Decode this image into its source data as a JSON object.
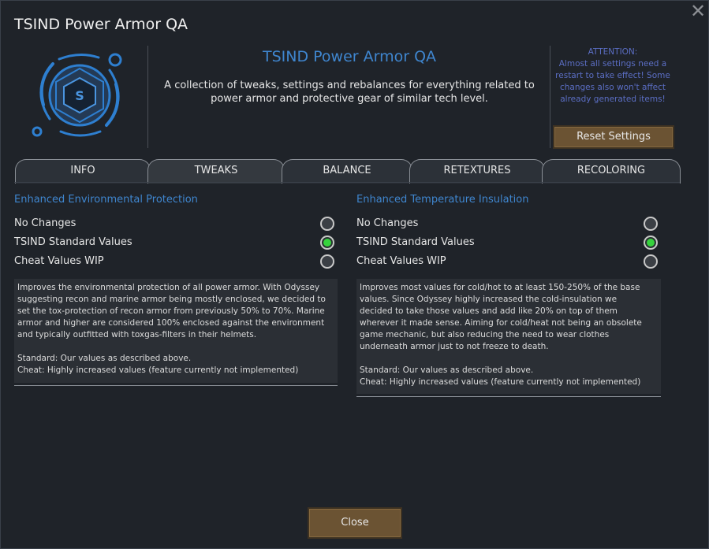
{
  "window": {
    "title": "TSIND Power Armor QA",
    "close_glyph": "✕"
  },
  "header": {
    "mod_title": "TSIND Power Armor QA",
    "description": "A collection of tweaks, settings and rebalances for everything related to power armor and protective gear of similar tech level.",
    "attention_title": "ATTENTION:",
    "attention_text": "Almost all settings need a restart to take effect! Some changes also won't affect already generated items!",
    "reset_label": "Reset Settings",
    "logo_icon": "tsind-logo-icon",
    "logo_letter": "S"
  },
  "tabs": [
    {
      "label": "INFO",
      "active": false
    },
    {
      "label": "TWEAKS",
      "active": true
    },
    {
      "label": "BALANCE",
      "active": false
    },
    {
      "label": "RETEXTURES",
      "active": false
    },
    {
      "label": "RECOLORING",
      "active": false
    }
  ],
  "sections": [
    {
      "title": "Enhanced Environmental Protection",
      "options": [
        {
          "label": "No Changes",
          "selected": false
        },
        {
          "label": "TSIND Standard Values",
          "selected": true
        },
        {
          "label": "Cheat Values WIP",
          "selected": false
        }
      ],
      "description": "Improves the environmental protection of all power armor. With Odyssey\nsuggesting recon and marine armor being mostly enclosed, we decided to\nset the tox-protection of recon armor from previously 50% to 70%. Marine\narmor and higher are considered 100% enclosed against the environment\nand typically outfitted with toxgas-filters in their helmets.\n\nStandard: Our values as described above.\nCheat: Highly increased values (feature currently not implemented)"
    },
    {
      "title": "Enhanced Temperature Insulation",
      "options": [
        {
          "label": "No Changes",
          "selected": false
        },
        {
          "label": "TSIND Standard Values",
          "selected": true
        },
        {
          "label": "Cheat Values WIP",
          "selected": false
        }
      ],
      "description": "Improves most values for cold/hot to at least 150-250% of the base\nvalues. Since Odyssey highly increased the cold-insulation we\ndecided to take those values and add like 20% on top of them\nwherever it made sense. Aiming for cold/heat not being an obsolete\ngame mechanic, but also reducing the need to wear clothes\nunderneath armor just to not freeze to death.\n\nStandard: Our values as described above.\nCheat: Highly increased values (feature currently not implemented)"
    }
  ],
  "footer": {
    "close_label": "Close"
  },
  "colors": {
    "accent_blue": "#3f86cf",
    "attention_blue": "#5b6ec4",
    "button_brown": "#6b5333",
    "radio_selected": "#36d33d",
    "background": "#1f2329"
  }
}
